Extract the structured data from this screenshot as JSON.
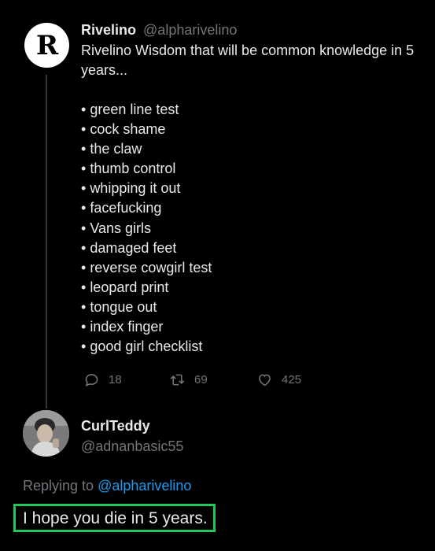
{
  "tweet": {
    "avatar_letter": "R",
    "display_name": "Rivelino",
    "handle": "@alpharivelino",
    "text": "Rivelino Wisdom that will be common knowledge in 5 years...",
    "bullets": [
      "green line test",
      "cock shame",
      "the claw",
      "thumb control",
      "whipping it out",
      "facefucking",
      "Vans girls",
      "damaged feet",
      "reverse cowgirl test",
      "leopard print",
      "tongue out",
      "index finger",
      "good girl checklist"
    ],
    "replies_count": "18",
    "retweets_count": "69",
    "likes_count": "425"
  },
  "reply": {
    "display_name": "CurlTeddy",
    "handle": "@adnanbasic55",
    "replying_to_label": "Replying to",
    "replying_to_handle": "@alpharivelino",
    "text": "I hope you die in 5 years.",
    "highlight_color": "#22c55e"
  },
  "colors": {
    "background": "#000000",
    "text": "#e7e9ea",
    "muted": "#71767b",
    "link": "#1d9bf0"
  },
  "icons": [
    "reply-icon",
    "retweet-icon",
    "like-icon"
  ]
}
